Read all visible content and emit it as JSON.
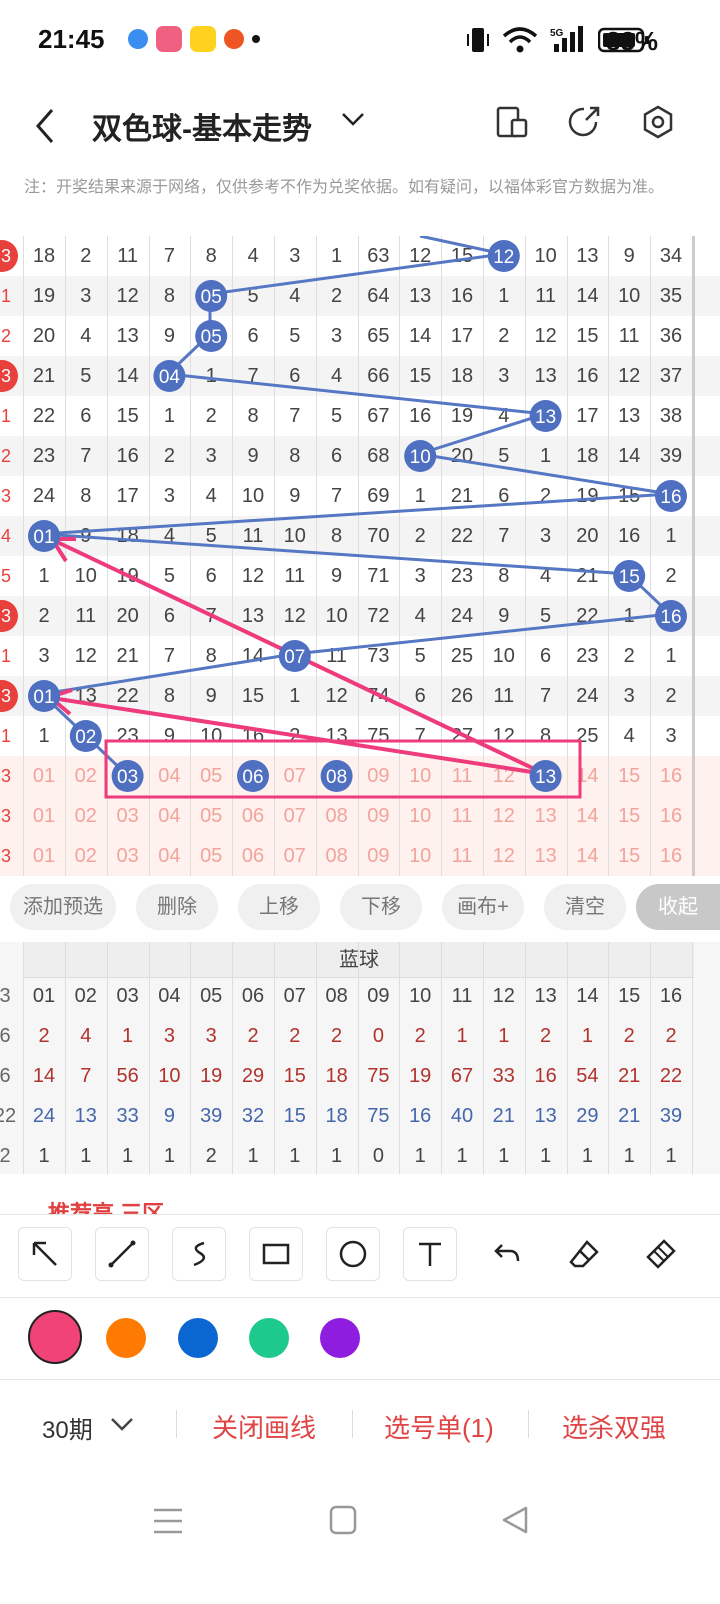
{
  "status_bar": {
    "time": "21:45",
    "battery": "83%",
    "network": "5G"
  },
  "header": {
    "back_icon": "chevron-left-icon",
    "title": "双色球-基本走势",
    "title_dropdown_icon": "chevron-down-icon",
    "icons": [
      "layout-toggle-icon",
      "share-icon",
      "settings-icon"
    ]
  },
  "note": "注：开奖结果来源于网络，仅供参考不作为兑奖依据。如有疑问，以福体彩官方数据为准。",
  "grid": {
    "left_markers": [
      "3",
      "1",
      "2",
      "3",
      "1",
      "2",
      "3",
      "4",
      "5",
      "3",
      "1",
      "3",
      "1",
      "3",
      "3",
      "3"
    ],
    "rows": [
      [
        "18",
        "2",
        "11",
        "7",
        "8",
        "4",
        "3",
        "1",
        "63",
        "12",
        "15",
        "12",
        "10",
        "13",
        "9",
        "34"
      ],
      [
        "19",
        "3",
        "12",
        "8",
        "05",
        "5",
        "4",
        "2",
        "64",
        "13",
        "16",
        "1",
        "11",
        "14",
        "10",
        "35"
      ],
      [
        "20",
        "4",
        "13",
        "9",
        "05",
        "6",
        "5",
        "3",
        "65",
        "14",
        "17",
        "2",
        "12",
        "15",
        "11",
        "36"
      ],
      [
        "21",
        "5",
        "14",
        "04",
        "1",
        "7",
        "6",
        "4",
        "66",
        "15",
        "18",
        "3",
        "13",
        "16",
        "12",
        "37"
      ],
      [
        "22",
        "6",
        "15",
        "1",
        "2",
        "8",
        "7",
        "5",
        "67",
        "16",
        "19",
        "4",
        "13",
        "17",
        "13",
        "38"
      ],
      [
        "23",
        "7",
        "16",
        "2",
        "3",
        "9",
        "8",
        "6",
        "68",
        "10",
        "20",
        "5",
        "1",
        "18",
        "14",
        "39"
      ],
      [
        "24",
        "8",
        "17",
        "3",
        "4",
        "10",
        "9",
        "7",
        "69",
        "1",
        "21",
        "6",
        "2",
        "19",
        "15",
        "16"
      ],
      [
        "01",
        "9",
        "18",
        "4",
        "5",
        "11",
        "10",
        "8",
        "70",
        "2",
        "22",
        "7",
        "3",
        "20",
        "16",
        "1"
      ],
      [
        "1",
        "10",
        "19",
        "5",
        "6",
        "12",
        "11",
        "9",
        "71",
        "3",
        "23",
        "8",
        "4",
        "21",
        "15",
        "2"
      ],
      [
        "2",
        "11",
        "20",
        "6",
        "7",
        "13",
        "12",
        "10",
        "72",
        "4",
        "24",
        "9",
        "5",
        "22",
        "1",
        "16"
      ],
      [
        "3",
        "12",
        "21",
        "7",
        "8",
        "14",
        "07",
        "11",
        "73",
        "5",
        "25",
        "10",
        "6",
        "23",
        "2",
        "1"
      ],
      [
        "01",
        "13",
        "22",
        "8",
        "9",
        "15",
        "1",
        "12",
        "74",
        "6",
        "26",
        "11",
        "7",
        "24",
        "3",
        "2"
      ],
      [
        "1",
        "02",
        "23",
        "9",
        "10",
        "16",
        "2",
        "13",
        "75",
        "7",
        "27",
        "12",
        "8",
        "25",
        "4",
        "3"
      ],
      [
        "01",
        "02",
        "03",
        "04",
        "05",
        "06",
        "07",
        "08",
        "09",
        "10",
        "11",
        "12",
        "13",
        "14",
        "15",
        "16"
      ],
      [
        "01",
        "02",
        "03",
        "04",
        "05",
        "06",
        "07",
        "08",
        "09",
        "10",
        "11",
        "12",
        "13",
        "14",
        "15",
        "16"
      ],
      [
        "01",
        "02",
        "03",
        "04",
        "05",
        "06",
        "07",
        "08",
        "09",
        "10",
        "11",
        "12",
        "13",
        "14",
        "15",
        "16"
      ]
    ]
  },
  "chips": [
    "添加预选",
    "删除",
    "上移",
    "下移",
    "画布+",
    "清空",
    "收起"
  ],
  "stats": {
    "title": "蓝球",
    "left_values": [
      "3",
      "6",
      "6",
      "22",
      "2"
    ],
    "header": [
      "01",
      "02",
      "03",
      "04",
      "05",
      "06",
      "07",
      "08",
      "09",
      "10",
      "11",
      "12",
      "13",
      "14",
      "15",
      "16"
    ],
    "rows": [
      [
        "2",
        "4",
        "1",
        "3",
        "3",
        "2",
        "2",
        "2",
        "0",
        "2",
        "1",
        "1",
        "2",
        "1",
        "2",
        "2"
      ],
      [
        "14",
        "7",
        "56",
        "10",
        "19",
        "29",
        "15",
        "18",
        "75",
        "19",
        "67",
        "33",
        "16",
        "54",
        "21",
        "22"
      ],
      [
        "24",
        "13",
        "33",
        "9",
        "39",
        "32",
        "15",
        "18",
        "75",
        "16",
        "40",
        "21",
        "13",
        "29",
        "21",
        "39"
      ],
      [
        "1",
        "1",
        "1",
        "1",
        "2",
        "1",
        "1",
        "1",
        "0",
        "1",
        "1",
        "1",
        "1",
        "1",
        "1",
        "1"
      ]
    ]
  },
  "card_peek": "推荐高 三区",
  "draw_tools": [
    "arrow-icon",
    "line-icon",
    "freehand-icon",
    "rectangle-icon",
    "circle-icon",
    "text-icon",
    "undo-icon",
    "eraser-icon",
    "clear-brush-icon"
  ],
  "colors": [
    "#f04378",
    "#ff7a00",
    "#0a66d0",
    "#1ec98c",
    "#8f1de0"
  ],
  "bottom": {
    "period": "30期",
    "close_draw": "关闭画线",
    "pick_list": "选号单(1)",
    "kill_double": "选杀双强"
  }
}
